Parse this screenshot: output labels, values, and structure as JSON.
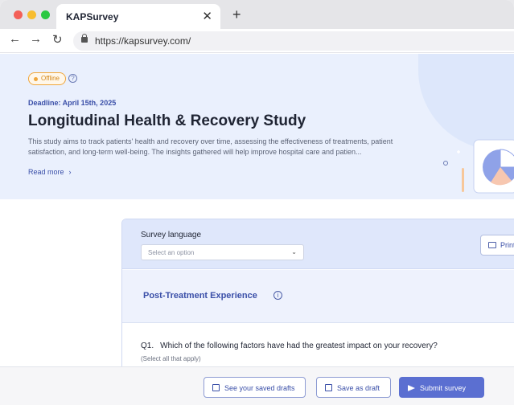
{
  "browser": {
    "tab_title": "KAPSurvey",
    "tab_close": "✕",
    "new_tab": "+",
    "url": "https://kapsurvey.com/",
    "nav_back": "←",
    "nav_forward": "→",
    "nav_reload": "↻"
  },
  "hero": {
    "status_badge": "Offline",
    "help_glyph": "?",
    "deadline": "Deadline: April 15th, 2025",
    "title": "Longitudinal Health & Recovery Study",
    "description": "This study aims to track patients' health and recovery over time, assessing the effectiveness of treatments, patient satisfaction, and long-term well-being. The insights gathered will help improve hospital care and patien...",
    "read_more": "Read more",
    "read_more_chevron": "›"
  },
  "survey": {
    "language_label": "Survey language",
    "language_placeholder": "Select an option",
    "select_chevron": "⌄",
    "print_label": "Print",
    "section_title": "Post-Treatment Experience",
    "section_info_glyph": "i",
    "question_number": "Q1.",
    "question_text": "Which of the following factors have had the greatest impact on your recovery?",
    "question_hint": "(Select all that apply)"
  },
  "footer": {
    "saved_drafts_label": "See your saved drafts",
    "save_draft_label": "Save as draft",
    "submit_label": "Submit survey"
  },
  "colors": {
    "accent": "#5b6fd1",
    "accent_text": "#3a4fa8",
    "hero_bg": "#eaf0fd",
    "offline_badge": "#f0a63a"
  }
}
